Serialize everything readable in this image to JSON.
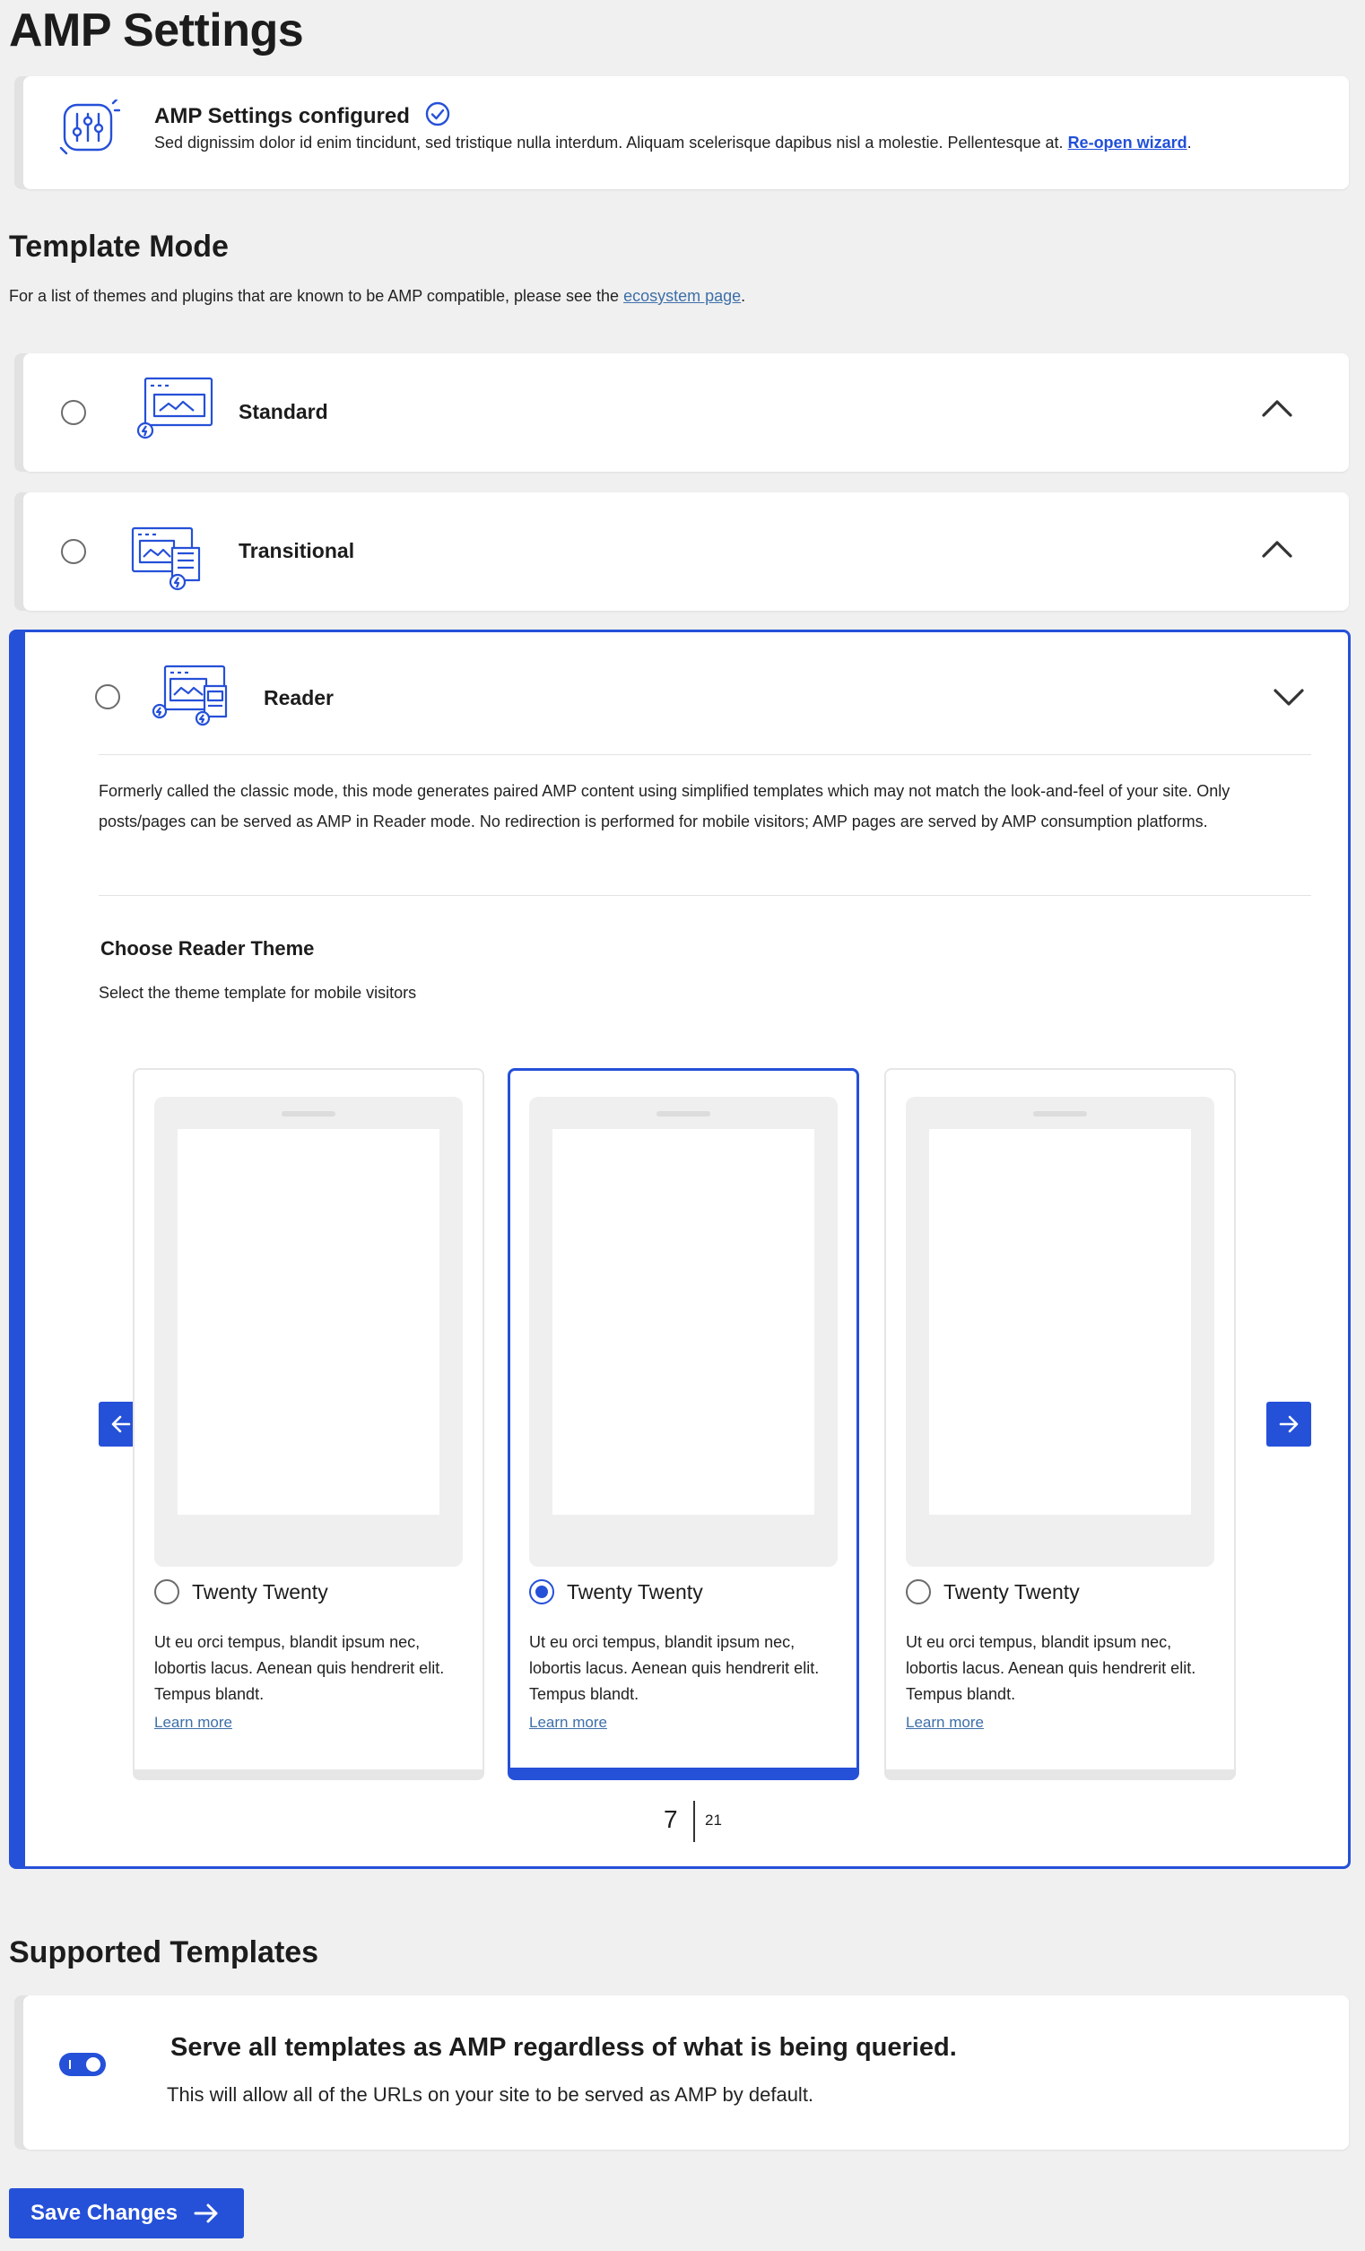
{
  "page": {
    "title": "AMP Settings"
  },
  "wizard": {
    "title": "AMP Settings configured",
    "description": "Sed dignissim dolor id enim tincidunt, sed tristique nulla interdum. Aliquam scelerisque dapibus nisl a molestie. Pellentesque at.",
    "link": "Re-open wizard",
    "period": "."
  },
  "template_mode": {
    "heading": "Template Mode",
    "intro": "For a list of themes and plugins that are known to be AMP compatible, please see the",
    "intro_link": "ecosystem page",
    "intro_end": ".",
    "modes": [
      {
        "label": "Standard",
        "expanded": false
      },
      {
        "label": "Transitional",
        "expanded": false
      },
      {
        "label": "Reader",
        "expanded": true
      }
    ],
    "reader_description": "Formerly called the classic mode, this mode generates paired AMP content using simplified templates which may not match the look-and-feel of your site. Only posts/pages can be served as AMP in Reader mode. No redirection is performed for mobile visitors; AMP pages are served by AMP consumption platforms."
  },
  "reader_theme": {
    "title": "Choose Reader Theme",
    "subtitle": "Select the theme template for mobile visitors",
    "themes": [
      {
        "name": "Twenty Twenty",
        "description": "Ut eu orci tempus, blandit ipsum nec, lobortis lacus. Aenean quis hendrerit elit. Tempus blandt.",
        "link": "Learn more",
        "selected": false
      },
      {
        "name": "Twenty Twenty",
        "description": "Ut eu orci tempus, blandit ipsum nec, lobortis lacus. Aenean quis hendrerit elit. Tempus blandt.",
        "link": "Learn more",
        "selected": true
      },
      {
        "name": "Twenty Twenty",
        "description": "Ut eu orci tempus, blandit ipsum nec, lobortis lacus. Aenean quis hendrerit elit. Tempus blandt.",
        "link": "Learn more",
        "selected": false
      }
    ],
    "pagination": {
      "current": "7",
      "total": "21"
    }
  },
  "supported_templates": {
    "heading": "Supported Templates",
    "toggle_on": true,
    "title": "Serve all templates as AMP regardless of what is being queried.",
    "description": "This will allow all of the URLs on your site to be served as AMP by default."
  },
  "actions": {
    "save_label": "Save Changes"
  },
  "colors": {
    "accent": "#2550d8",
    "background": "#f0f0f0",
    "card": "#ffffff"
  },
  "icons": [
    "settings-sliders-icon",
    "check-circle-icon",
    "standard-mode-icon",
    "transitional-mode-icon",
    "reader-mode-icon",
    "chevron-up-icon",
    "chevron-down-icon",
    "arrow-left-icon",
    "arrow-right-icon"
  ]
}
